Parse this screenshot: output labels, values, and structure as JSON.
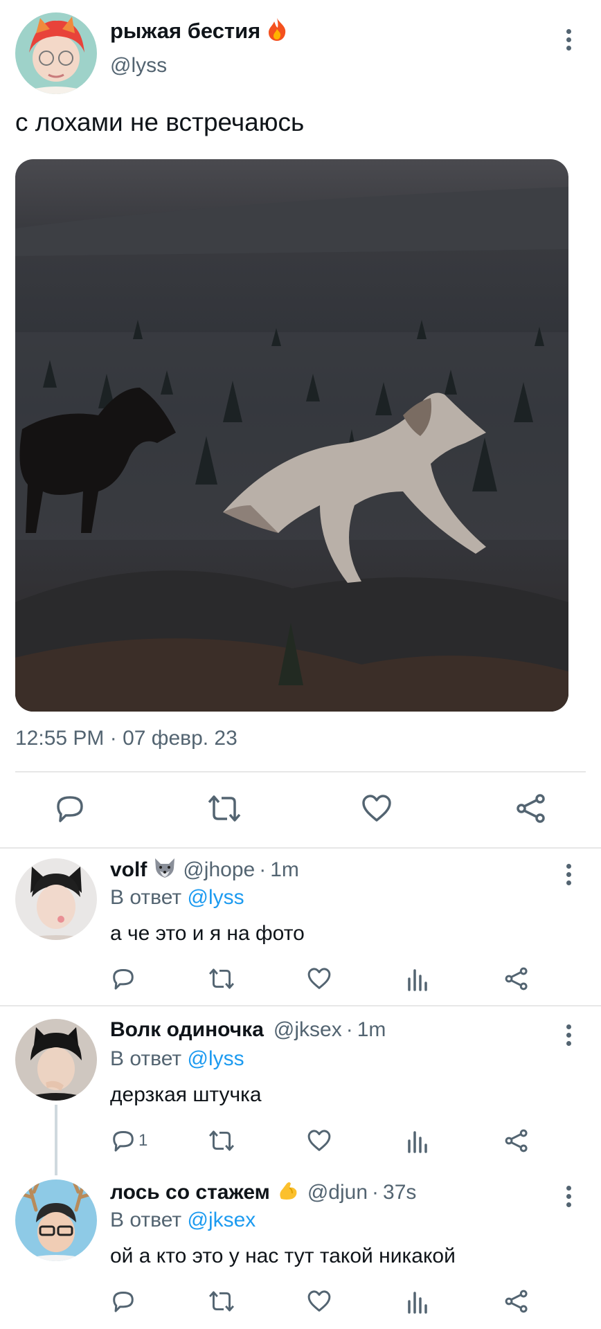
{
  "main_tweet": {
    "display_name": "рыжая бестия",
    "handle": "@lyss",
    "text": "с лохами не встречаюсь",
    "timestamp": "12:55 PM · 07 февр. 23",
    "name_emoji": "fire"
  },
  "replies": [
    {
      "display_name": "volf",
      "name_emoji": "wolf",
      "handle": "@jhope",
      "time": "1m",
      "reply_prefix": "В ответ",
      "reply_to": "@lyss",
      "text": "а че это и я на фото",
      "reply_count": ""
    },
    {
      "display_name": "Волк одиночка",
      "handle": "@jksex",
      "time": "1m",
      "reply_prefix": "В ответ",
      "reply_to": "@lyss",
      "text": "дерзкая штучка",
      "reply_count": "1"
    },
    {
      "display_name": "лось со стажем",
      "name_emoji": "flexed-biceps",
      "handle": "@djun",
      "time": "37s",
      "reply_prefix": "В ответ",
      "reply_to": "@jksex",
      "text": "ой а кто это у нас тут такой никакой",
      "reply_count": ""
    }
  ],
  "colors": {
    "text": "#0f1419",
    "secondary": "#536471",
    "link": "#1d9bf0",
    "divider": "#e7e7e7"
  }
}
